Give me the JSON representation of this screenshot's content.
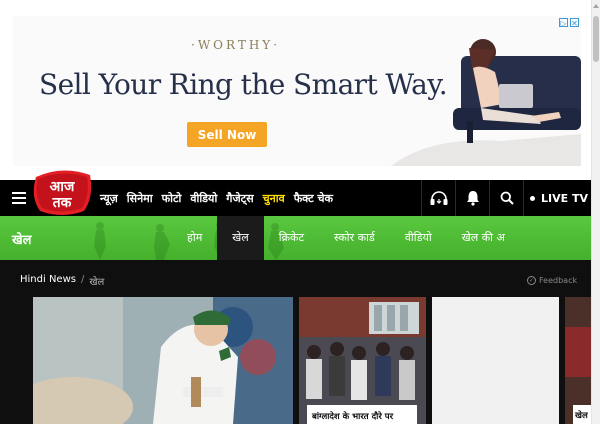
{
  "ad": {
    "brand": "WORTHY",
    "headline": "Sell Your Ring the Smart Way.",
    "cta": "Sell Now",
    "close_icons": [
      "adchoices-icon",
      "close-icon"
    ]
  },
  "site": {
    "logo_text": "आज तक",
    "nav_links": [
      "न्यूज़",
      "सिनेमा",
      "फोटो",
      "वीडियो",
      "गैजेट्स",
      "चुनाव",
      "फैक्ट चेक"
    ],
    "nav_highlight": "चुनाव",
    "live_label": "LIVE TV",
    "colors": {
      "nav_bg": "#000000",
      "highlight": "#ffdd00",
      "logo_red": "#e31e24",
      "section_green": "#4bb531"
    }
  },
  "section": {
    "title": "खेल",
    "tabs": [
      "होम",
      "खेल",
      "क्रिकेट",
      "स्कोर कार्ड",
      "वीडियो",
      "खेल की अ"
    ],
    "active_tab": "खेल"
  },
  "breadcrumb": {
    "home": "Hindi News",
    "separator": "/",
    "current": "खेल"
  },
  "feedback_label": "Feedback",
  "cards": {
    "mid_caption": "बांग्लादेश के भारत दौरे पर",
    "right_caption": "खेल"
  }
}
